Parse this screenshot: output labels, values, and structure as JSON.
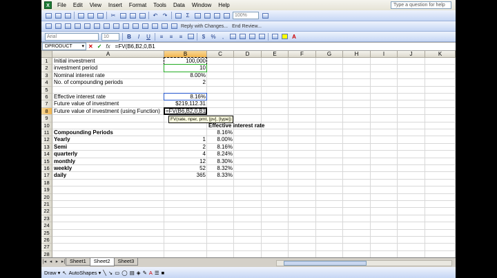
{
  "menu": [
    "File",
    "Edit",
    "View",
    "Insert",
    "Format",
    "Tools",
    "Data",
    "Window",
    "Help"
  ],
  "help_placeholder": "Type a question for help",
  "toolbar": {
    "zoom": "100%",
    "font_name": "Arial",
    "font_size": "10",
    "reply_label": "Reply with Changes...",
    "end_review_label": "End Review...",
    "bold": "B",
    "italic": "I",
    "underline": "U",
    "sigma": "Σ"
  },
  "formula_bar": {
    "name_box": "DPRODUCT",
    "fx": "fx",
    "cancel": "✕",
    "enter": "✓",
    "formula": "=FV(B6,B2,0,B1"
  },
  "columns": [
    "A",
    "B",
    "C",
    "D",
    "E",
    "F",
    "G",
    "H",
    "I",
    "J",
    "K"
  ],
  "rows": [
    "1",
    "2",
    "3",
    "4",
    "5",
    "6",
    "7",
    "8",
    "9",
    "10",
    "11",
    "12",
    "13",
    "14",
    "15",
    "16",
    "17",
    "18",
    "19",
    "20",
    "21",
    "22",
    "23",
    "24",
    "25",
    "26",
    "27",
    "28"
  ],
  "cells": {
    "A1": "Initial investment",
    "B1": "100,000",
    "A2": "investment period",
    "B2": "10",
    "A3": "Nominal interest rate",
    "B3": "8.00%",
    "A4": "No. of compounding periods",
    "B4": "2",
    "A6": "Effective interest rate",
    "B6": "8.16%",
    "A7": "Future value of investment",
    "B7": "$219,112.31",
    "A8": "Future value of investment (using Function)",
    "B8": "=FV(B6,B2,0,B1",
    "C10": "Effective interest rate",
    "A11": "Compounding Periods",
    "C11": "8.16%",
    "A12": "Yearly",
    "B12": "1",
    "C12": "8.00%",
    "A13": "Semi",
    "B13": "2",
    "C13": "8.16%",
    "A14": "quarterly",
    "B14": "4",
    "C14": "8.24%",
    "A15": "monthly",
    "B15": "12",
    "C15": "8.30%",
    "A16": "weekly",
    "B16": "52",
    "C16": "8.32%",
    "A17": "daily",
    "B17": "365",
    "C17": "8.33%"
  },
  "tooltip": "FV(rate, nper, pmt, [pv], [type])",
  "sheets": [
    "Sheet1",
    "Sheet2",
    "Sheet3"
  ],
  "active_sheet": "Sheet2",
  "drawbar": {
    "draw": "Draw ▾",
    "autoshapes": "AutoShapes ▾"
  }
}
